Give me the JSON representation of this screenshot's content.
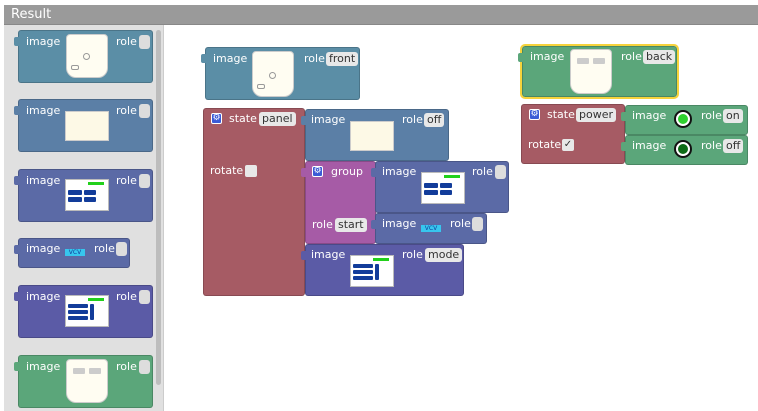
{
  "window": {
    "title": "Result"
  },
  "labels": {
    "image": "image",
    "role": "role",
    "state": "state",
    "rotate": "rotate",
    "group": "group"
  },
  "flyout": {
    "blocks": [
      {
        "name": "flyout-block-front",
        "color": "#5b8ea6",
        "thumbnail": "device-front"
      },
      {
        "name": "flyout-block-blank",
        "color": "#5b7fa6",
        "thumbnail": "blank-panel"
      },
      {
        "name": "flyout-block-panel",
        "color": "#5b6aa6",
        "thumbnail": "panel-mini"
      },
      {
        "name": "flyout-block-vcv",
        "color": "#5b6aa6",
        "thumbnail": "vcv-button",
        "vcv_label": "VCV"
      },
      {
        "name": "flyout-block-mode",
        "color": "#5b5ba6",
        "thumbnail": "mode-panel"
      },
      {
        "name": "flyout-block-back",
        "color": "#5ba67a",
        "thumbnail": "device-back"
      }
    ]
  },
  "workspace": {
    "front_block": {
      "role": "front"
    },
    "back_block": {
      "role": "back"
    },
    "panel_state": {
      "state": "panel",
      "rotate_checked": false,
      "off_role": "off",
      "group": {
        "start_role": "start",
        "vcv_label": "VCV"
      },
      "mode_role": "mode"
    },
    "power_state": {
      "state": "power",
      "rotate_checked": true,
      "rotate_mark": "✓",
      "on_role": "on",
      "off_role": "off"
    }
  },
  "colors": {
    "image_block": "#5b8ea6",
    "state_block": "#a65b64",
    "group_block": "#a65ba6",
    "green_block": "#5ba67a",
    "selection": "#f6d33c"
  }
}
